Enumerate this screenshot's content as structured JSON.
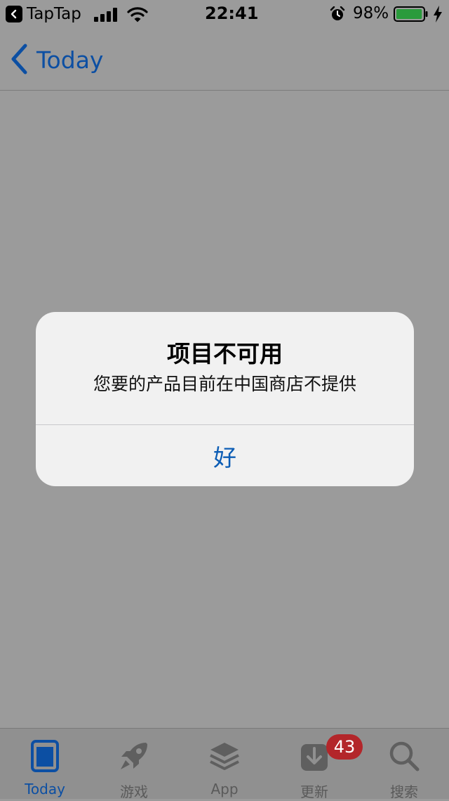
{
  "status_bar": {
    "back_app": "TapTap",
    "time": "22:41",
    "battery_percent": "98%",
    "battery_level": 0.98,
    "icons": [
      "back-icon",
      "signal-icon",
      "wifi-icon",
      "alarm-icon",
      "battery-icon",
      "charge-icon"
    ]
  },
  "nav": {
    "back_label": "Today",
    "back_icon": "chevron-left-icon"
  },
  "alert": {
    "title": "项目不可用",
    "message": "您要的产品目前在中国商店不提供",
    "button": "好"
  },
  "tabs": [
    {
      "label": "Today",
      "icon": "today-icon",
      "active": true
    },
    {
      "label": "游戏",
      "icon": "rocket-icon",
      "active": false
    },
    {
      "label": "App",
      "icon": "apps-stack-icon",
      "active": false
    },
    {
      "label": "更新",
      "icon": "update-icon",
      "active": false
    },
    {
      "label": "搜索",
      "icon": "search-icon",
      "active": false
    }
  ],
  "updates_badge": "43",
  "colors": {
    "accent": "#0c4fa3",
    "badge": "#b3262a",
    "battery": "#2a9b3c",
    "overlay_bg": "#9b9b9b"
  }
}
